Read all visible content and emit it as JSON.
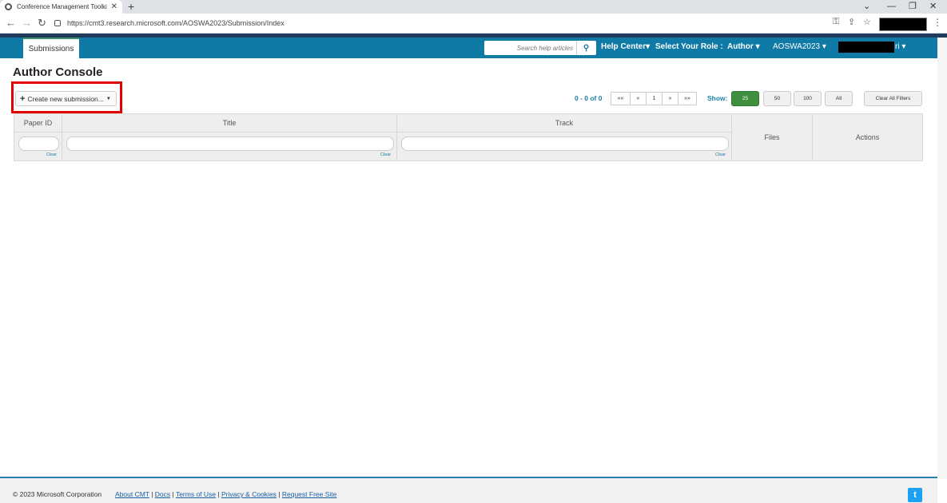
{
  "browser": {
    "tab_title": "Conference Management Toolki",
    "url": "https://cmt3.research.microsoft.com/AOSWA2023/Submission/Index"
  },
  "nav": {
    "tab_label": "Submissions",
    "search_placeholder": "Search help articles",
    "help_center": "Help Center",
    "role_label": "Select Your Role :",
    "role_value": "Author",
    "conference": "AOSWA2023",
    "user_suffix": "ri"
  },
  "page": {
    "title": "Author Console",
    "create_button": "Create new submission..."
  },
  "pager": {
    "count": "0 - 0 of 0",
    "first": "««",
    "prev": "«",
    "current": "1",
    "next": "»",
    "last": "»»",
    "show_label": "Show:",
    "show_options": [
      "25",
      "50",
      "100",
      "All"
    ],
    "clear_all": "Clear All Filters"
  },
  "table": {
    "columns": [
      "Paper ID",
      "Title",
      "Track",
      "Files",
      "Actions"
    ],
    "clear_label": "Clear"
  },
  "footer": {
    "copyright": "© 2023 Microsoft Corporation",
    "links": [
      "About CMT",
      "Docs",
      "Terms of Use",
      "Privacy & Cookies",
      "Request Free Site"
    ]
  },
  "colors": {
    "nav_bg": "#0e7aa5",
    "accent_link": "#1a7fa8",
    "active_show": "#3f8f3f",
    "highlight": "#e30000"
  }
}
